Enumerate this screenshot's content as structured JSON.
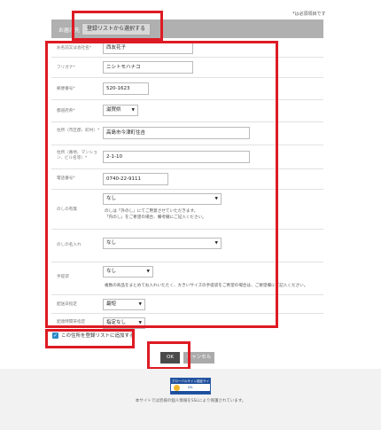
{
  "required_note": "*は必須項目です",
  "header": {
    "title": "お届け先",
    "select_from_list": "登録リストから選択する"
  },
  "form": {
    "name": {
      "label": "お名前又は会社名*",
      "value": "西友花子"
    },
    "kana": {
      "label": "フリガナ*",
      "value": "ニシトモハナコ"
    },
    "zip": {
      "label": "郵便番号*",
      "value": "520-1623"
    },
    "prefecture": {
      "label": "都道府県*",
      "value": "滋賀県"
    },
    "address1": {
      "label": "住所（市区郡、町村）*",
      "value": "高島市今津町住吉"
    },
    "address2": {
      "label": "住所（番地、マンション、ビル名等）*",
      "value": "2-1-10"
    },
    "phone": {
      "label": "電話番号*",
      "value": "0740-22-9111"
    },
    "noshi": {
      "label": "のしの有無",
      "value": "なし",
      "note_line1": "のしは「外のし」にてご用意させていただきます。",
      "note_line2": "「内のし」をご希望の場合、備考欄にご記入ください。"
    },
    "noshi_name": {
      "label": "のしの名入れ",
      "value": "なし"
    },
    "bag": {
      "label": "手提袋",
      "value": "なし",
      "note": "複数の商品をまとめてお入れいたたく、大きいサイズの手提袋をご希望の場合は、ご要望欄にご記入ください。"
    },
    "delivery_date": {
      "label": "配送日指定",
      "value": "最短"
    },
    "delivery_time": {
      "label": "配達時間帯指定",
      "value": "指定なし"
    }
  },
  "save_checkbox": {
    "label": "この住所を登録リストに追加する",
    "checked": true
  },
  "buttons": {
    "ok": "OK",
    "cancel": "キャンセル"
  },
  "footer": {
    "badge_top": "グローバルサイン認証サイト",
    "badge_mid": "SSL",
    "note": "本サイトでは皆様の個人情報をSSLにより保護されています。"
  },
  "colors": {
    "highlight": "#dd1b24",
    "header_bg": "#b0b0b0",
    "checkbox": "#2b88c6"
  }
}
